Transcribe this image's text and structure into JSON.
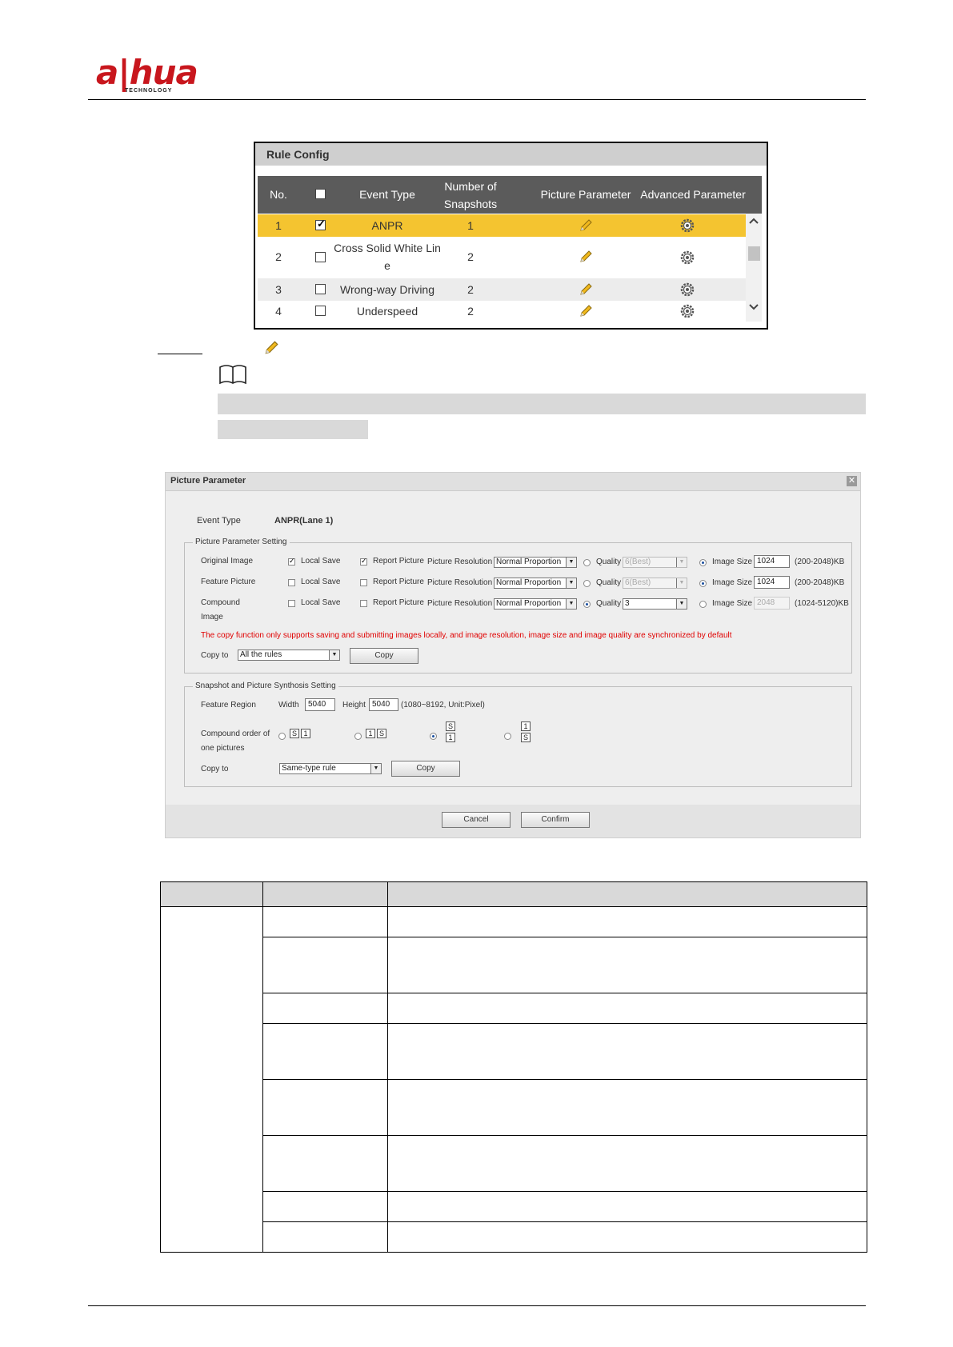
{
  "header": {
    "logo_text": "a|hua",
    "logo_sub": "TECHNOLOGY"
  },
  "rule_config": {
    "title": "Rule Config",
    "columns": [
      "No.",
      "",
      "Event Type",
      "Number of Snapshots",
      "Picture Parameter",
      "Advanced Parameter"
    ],
    "rows": [
      {
        "no": "1",
        "checked": true,
        "event_type": "ANPR",
        "snapshots": "1",
        "highlight": true
      },
      {
        "no": "2",
        "checked": false,
        "event_type": "Cross Solid White Line",
        "event_line1": "Cross Solid White Lin",
        "event_line2": "e",
        "snapshots": "2",
        "highlight": false
      },
      {
        "no": "3",
        "checked": false,
        "event_type": "Wrong-way Driving",
        "snapshots": "2",
        "highlight": false
      },
      {
        "no": "4",
        "checked": false,
        "event_type": "Underspeed",
        "snapshots": "2",
        "highlight": false
      }
    ]
  },
  "picture_parameter": {
    "title": "Picture Parameter",
    "event_type_label": "Event Type",
    "event_type_value": "ANPR(Lane 1)",
    "setting_legend": "Picture Parameter Setting",
    "rows": [
      {
        "name": "Original Image",
        "local_save": "Local Save",
        "local_checked": true,
        "report": "Report Picture",
        "report_checked": true,
        "res_label": "Picture Resolution",
        "res_value": "Normal Proportion",
        "quality_label": "Quality",
        "quality_value": "6(Best)",
        "quality_on": false,
        "size_label": "Image Size",
        "size_value": "1024",
        "size_on": true,
        "range": "(200-2048)KB"
      },
      {
        "name": "Feature Picture",
        "local_save": "Local Save",
        "local_checked": false,
        "report": "Report Picture",
        "report_checked": false,
        "res_label": "Picture Resolution",
        "res_value": "Normal Proportion",
        "quality_label": "Quality",
        "quality_value": "6(Best)",
        "quality_on": false,
        "size_label": "Image Size",
        "size_value": "1024",
        "size_on": true,
        "range": "(200-2048)KB"
      },
      {
        "name_line1": "Compound",
        "name_line2": "Image",
        "local_save": "Local Save",
        "local_checked": false,
        "report": "Report Picture",
        "report_checked": false,
        "res_label": "Picture Resolution",
        "res_value": "Normal Proportion",
        "quality_label": "Quality",
        "quality_value": "3",
        "quality_on": true,
        "size_label": "Image Size",
        "size_value": "2048",
        "size_on": false,
        "range": "(1024-5120)KB"
      }
    ],
    "notice": "The copy function only supports saving and submitting images locally, and image resolution, image size and image quality are synchronized by default",
    "copy_to_label": "Copy to",
    "copy_to_value": "All the rules",
    "copy_button": "Copy",
    "synthesis_legend": "Snapshot and Picture Synthosis Setting",
    "feature_region_label": "Feature Region",
    "width_label": "Width",
    "width_value": "5040",
    "height_label": "Height",
    "height_value": "5040",
    "region_range": "(1080~8192, Unit:Pixel)",
    "compound_order_line1": "Compound order of",
    "compound_order_line2": "one pictures",
    "order_options": [
      {
        "a": "S",
        "b": "1",
        "layout": "horizontal",
        "selected": false
      },
      {
        "a": "1",
        "b": "S",
        "layout": "horizontal",
        "selected": false
      },
      {
        "a": "S",
        "b": "1",
        "layout": "vertical",
        "selected": true
      },
      {
        "a": "1",
        "b": "S",
        "layout": "vertical",
        "selected": false
      }
    ],
    "copy_to2_label": "Copy to",
    "copy_to2_value": "Same-type rule",
    "copy_button2": "Copy",
    "cancel": "Cancel",
    "confirm": "Confirm"
  }
}
